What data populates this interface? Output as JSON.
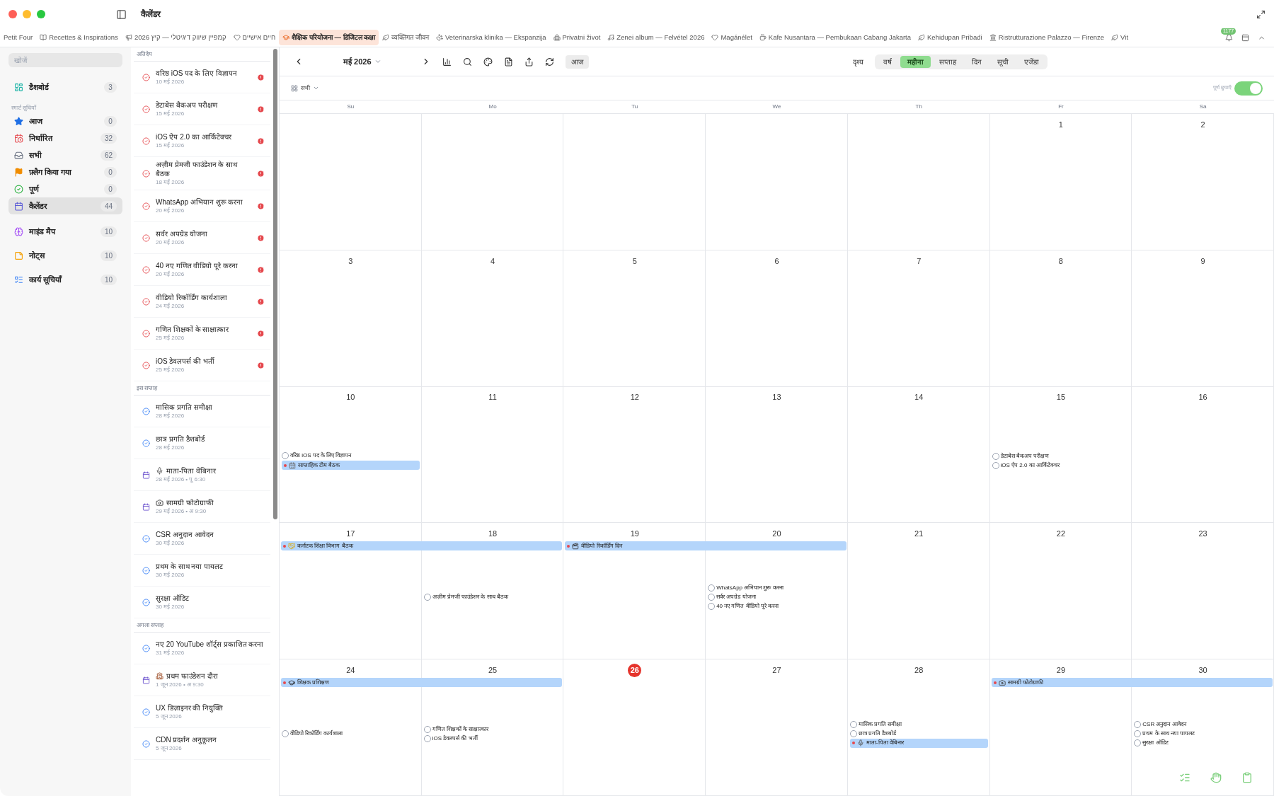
{
  "window": {
    "title": "कैलेंडर"
  },
  "tabs": [
    {
      "label": "Petit Four",
      "selected": false
    },
    {
      "label": "Recettes & Inspirations",
      "selected": false
    },
    {
      "label": "קמפיין שיווק דיגיטלי — קיץ 2026",
      "selected": false
    },
    {
      "label": "חיים אישיים",
      "selected": false
    },
    {
      "label": "शैक्षिक परियोजना — डिजिटल कक्षा",
      "selected": true
    },
    {
      "label": "व्यक्तिगत जीवन",
      "selected": false
    },
    {
      "label": "Veterinarska klinika — Ekspanzija",
      "selected": false
    },
    {
      "label": "Privatni život",
      "selected": false
    },
    {
      "label": "Zenei album — Felvétel 2026",
      "selected": false
    },
    {
      "label": "Magánélet",
      "selected": false
    },
    {
      "label": "Kafe Nusantara — Pembukaan Cabang Jakarta",
      "selected": false
    },
    {
      "label": "Kehidupan Pribadi",
      "selected": false
    },
    {
      "label": "Ristrutturazione Palazzo — Firenze",
      "selected": false
    },
    {
      "label": "Vit",
      "selected": false
    }
  ],
  "notifications": {
    "badge": "1177"
  },
  "sidebar": {
    "search": {
      "placeholder": "खोजें"
    },
    "items": [
      {
        "label": "डैशबोर्ड",
        "count": "3",
        "selected": false
      }
    ],
    "smart_lists": {
      "title": "स्मार्ट सूचियाँ",
      "items": [
        {
          "label": "आज",
          "count": "0",
          "selected": false
        },
        {
          "label": "निर्धारित",
          "count": "32",
          "selected": false
        },
        {
          "label": "सभी",
          "count": "62",
          "selected": false
        },
        {
          "label": "फ़्लैग किया गया",
          "count": "0",
          "selected": false
        },
        {
          "label": "पूर्ण",
          "count": "0",
          "selected": false
        },
        {
          "label": "कैलेंडर",
          "count": "44",
          "selected": true
        }
      ]
    },
    "more_items": [
      {
        "label": "माइंड मैप",
        "count": "10",
        "selected": false
      },
      {
        "label": "नोट्स",
        "count": "10",
        "selected": false
      },
      {
        "label": "कार्य सूचियाँ",
        "count": "10",
        "selected": false
      }
    ]
  },
  "task_list": {
    "sections": [
      {
        "title": "अतिदेय",
        "items": [
          {
            "kind": "task",
            "title": "वरिष्ठ iOS पद के लिए विज्ञापन",
            "date": "10 मई 2026",
            "overdue": true
          },
          {
            "kind": "task",
            "title": "डेटाबेस बैकअप परीक्षण",
            "date": "15 मई 2026",
            "overdue": true
          },
          {
            "kind": "task",
            "title": "iOS ऐप 2.0 का आर्किटेक्चर",
            "date": "15 मई 2026",
            "overdue": true
          },
          {
            "kind": "task",
            "title": "अज़ीम प्रेमजी फाउंडेशन के साथ बैठक",
            "date": "18 मई 2026",
            "overdue": true
          },
          {
            "kind": "task",
            "title": "WhatsApp अभियान शुरू करना",
            "date": "20 मई 2026",
            "overdue": true
          },
          {
            "kind": "task",
            "title": "सर्वर अपग्रेड योजना",
            "date": "20 मई 2026",
            "overdue": true
          },
          {
            "kind": "task",
            "title": "40 नए गणित वीडियो पूरे करना",
            "date": "20 मई 2026",
            "overdue": true
          },
          {
            "kind": "task",
            "title": "वीडियो रिकॉर्डिंग कार्यशाला",
            "date": "24 मई 2026",
            "overdue": true
          },
          {
            "kind": "task",
            "title": "गणित शिक्षकों के साक्षात्कार",
            "date": "25 मई 2026",
            "overdue": true
          },
          {
            "kind": "task",
            "title": "iOS डेवलपर्स की भर्ती",
            "date": "25 मई 2026",
            "overdue": true
          }
        ]
      },
      {
        "title": "इस सप्ताह",
        "items": [
          {
            "kind": "task",
            "title": "मासिक प्रगति समीक्षा",
            "date": "28 मई 2026",
            "overdue": false
          },
          {
            "kind": "task",
            "title": "छात्र प्रगति डैशबोर्ड",
            "date": "28 मई 2026",
            "overdue": false
          },
          {
            "kind": "webinar",
            "title": "माता-पिता वेबिनार",
            "date": "28 मई 2026 • पू 6:30",
            "overdue": false
          },
          {
            "kind": "photoshoot",
            "title": "सामग्री फोटोग्राफी",
            "date": "29 मई 2026 • अ 9:30",
            "overdue": false
          },
          {
            "kind": "task",
            "title": "CSR अनुदान आवेदन",
            "date": "30 मई 2026",
            "overdue": false
          },
          {
            "kind": "task",
            "title": "प्रथम के साथ नया पायलट",
            "date": "30 मई 2026",
            "overdue": false
          },
          {
            "kind": "task",
            "title": "सुरक्षा ऑडिट",
            "date": "30 मई 2026",
            "overdue": false
          }
        ]
      },
      {
        "title": "अगला सप्ताह",
        "items": [
          {
            "kind": "task",
            "title": "नए 20 YouTube शॉर्ट्स प्रकाशित करना",
            "date": "31 मई 2026",
            "overdue": false
          },
          {
            "kind": "visit",
            "title": "प्रथम फाउंडेशन दौरा",
            "date": "1 जून 2026 • अ 9:30",
            "overdue": false
          },
          {
            "kind": "task",
            "title": "UX डिज़ाइनर की नियुक्ति",
            "date": "5 जून 2026",
            "overdue": false
          },
          {
            "kind": "task",
            "title": "CDN प्रदर्शन अनुकूलन",
            "date": "5 जून 2026",
            "overdue": false
          }
        ]
      }
    ]
  },
  "calendar": {
    "month": "मई 2026",
    "today_button": "आज",
    "view_label": "दृश्य",
    "views": [
      {
        "label": "वर्ष",
        "selected": false
      },
      {
        "label": "महीना",
        "selected": true
      },
      {
        "label": "सप्ताह",
        "selected": false
      },
      {
        "label": "दिन",
        "selected": false
      },
      {
        "label": "सूची",
        "selected": false
      },
      {
        "label": "एजेंडा",
        "selected": false
      }
    ],
    "filter": "सभी",
    "hide_completed": {
      "label": "पूर्ण छुपाएँ",
      "on": true
    },
    "weekdays": [
      "Su",
      "Mo",
      "Tu",
      "We",
      "Th",
      "Fr",
      "Sa"
    ],
    "weeks": [
      {
        "days": [
          {
            "number": "1"
          },
          {
            "number": "2"
          }
        ]
      },
      {
        "days": [
          {
            "number": "3"
          },
          {
            "number": "4"
          },
          {
            "number": "5"
          },
          {
            "number": "6"
          },
          {
            "number": "7"
          },
          {
            "number": "8"
          },
          {
            "number": "9"
          }
        ]
      },
      {
        "days": [
          {
            "number": "10",
            "items": [
              {
                "kind": "task",
                "title": "वरिष्ठ iOS पद के लिए विज्ञापन",
                "done": false
              },
              {
                "kind": "meeting",
                "title": "साप्ताहिक टीम बैठक"
              }
            ]
          },
          {
            "number": "11"
          },
          {
            "number": "12"
          },
          {
            "number": "13"
          },
          {
            "number": "14"
          },
          {
            "number": "15",
            "items": [
              {
                "kind": "task",
                "title": "डेटाबेस बैकअप परीक्षण",
                "done": false
              },
              {
                "kind": "task",
                "title": "iOS ऐप 2.0 का आर्किटेक्चर",
                "done": false
              }
            ]
          },
          {
            "number": "16"
          }
        ]
      },
      {
        "days": [
          {
            "number": "17",
            "allday": {
              "kind": "conference",
              "title": "कर्नाटक शिक्षा विभाग बैठक"
            }
          },
          {
            "number": "18",
            "covered": true,
            "items": [
              {
                "kind": "task",
                "title": "अज़ीम प्रेमजी फाउंडेशन के साथ बैठक",
                "done": false
              }
            ]
          },
          {
            "number": "19",
            "allday": {
              "kind": "filming",
              "title": "वीडियो रिकॉर्डिंग दिन"
            }
          },
          {
            "number": "20",
            "covered": true,
            "items": [
              {
                "kind": "task",
                "title": "WhatsApp अभियान शुरू करना",
                "done": false
              },
              {
                "kind": "task",
                "title": "सर्वर अपग्रेड योजना",
                "done": false
              },
              {
                "kind": "task",
                "title": "40 नए गणित वीडियो पूरे करना",
                "done": false
              }
            ]
          },
          {
            "number": "21"
          },
          {
            "number": "22"
          },
          {
            "number": "23"
          }
        ]
      },
      {
        "days": [
          {
            "number": "24",
            "allday": {
              "kind": "training",
              "title": "शिक्षक प्रशिक्षण"
            },
            "items": [
              {
                "kind": "task",
                "title": "वीडियो रिकॉर्डिंग कार्यशाला",
                "done": false
              }
            ]
          },
          {
            "number": "25",
            "covered": true,
            "items": [
              {
                "kind": "task",
                "title": "गणित शिक्षकों के साक्षात्कार",
                "done": false
              },
              {
                "kind": "task",
                "title": "iOS डेवलपर्स की भर्ती",
                "done": false
              }
            ]
          },
          {
            "number": "26",
            "today": true
          },
          {
            "number": "27"
          },
          {
            "number": "28",
            "items": [
              {
                "kind": "task",
                "title": "मासिक प्रगति समीक्षा",
                "done": false
              },
              {
                "kind": "task",
                "title": "छात्र प्रगति डैशबोर्ड",
                "done": false
              },
              {
                "kind": "webinar",
                "title": "माता-पिता वेबिनार"
              }
            ]
          },
          {
            "number": "29",
            "allday": {
              "kind": "photoshoot",
              "title": "सामग्री फोटोग्राफी"
            }
          },
          {
            "number": "30",
            "covered": true,
            "items": [
              {
                "kind": "task",
                "title": "CSR अनुदान आवेदन",
                "done": false
              },
              {
                "kind": "task",
                "title": "प्रथम के साथ नया पायलट",
                "done": false
              },
              {
                "kind": "task",
                "title": "सुरक्षा ऑडिट",
                "done": false
              }
            ]
          }
        ]
      }
    ]
  }
}
